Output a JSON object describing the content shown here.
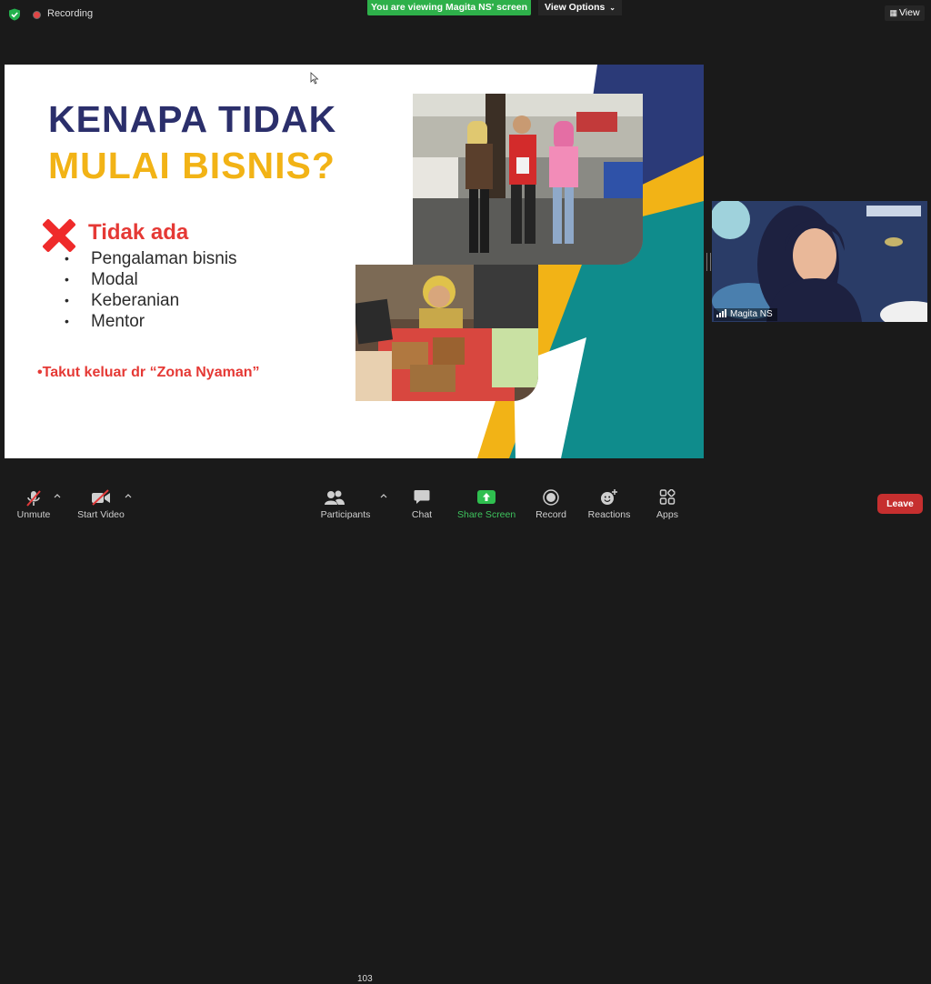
{
  "top": {
    "recording": "Recording",
    "viewing_banner": "You are viewing Magita NS' screen",
    "view_options": "View Options",
    "view_button": "View"
  },
  "slide": {
    "title_line1": "KENAPA TIDAK",
    "title_line2": "MULAI BISNIS?",
    "tidak_ada": "Tidak ada",
    "bullet_char": "•",
    "bullets": [
      "Pengalaman bisnis",
      "Modal",
      "Keberanian",
      "Mentor"
    ],
    "takut": "Takut keluar dr “Zona Nyaman”",
    "colors": {
      "navy": "#2b2f6b",
      "gold": "#f2b316",
      "red": "#e53935",
      "teal": "#0f8c8c"
    }
  },
  "video": {
    "participant_name": "Magita NS"
  },
  "toolbar": {
    "unmute": "Unmute",
    "start_video": "Start Video",
    "participants": "Participants",
    "participants_count": "103",
    "chat": "Chat",
    "share_screen": "Share Screen",
    "record": "Record",
    "reactions": "Reactions",
    "apps": "Apps",
    "leave": "Leave"
  }
}
